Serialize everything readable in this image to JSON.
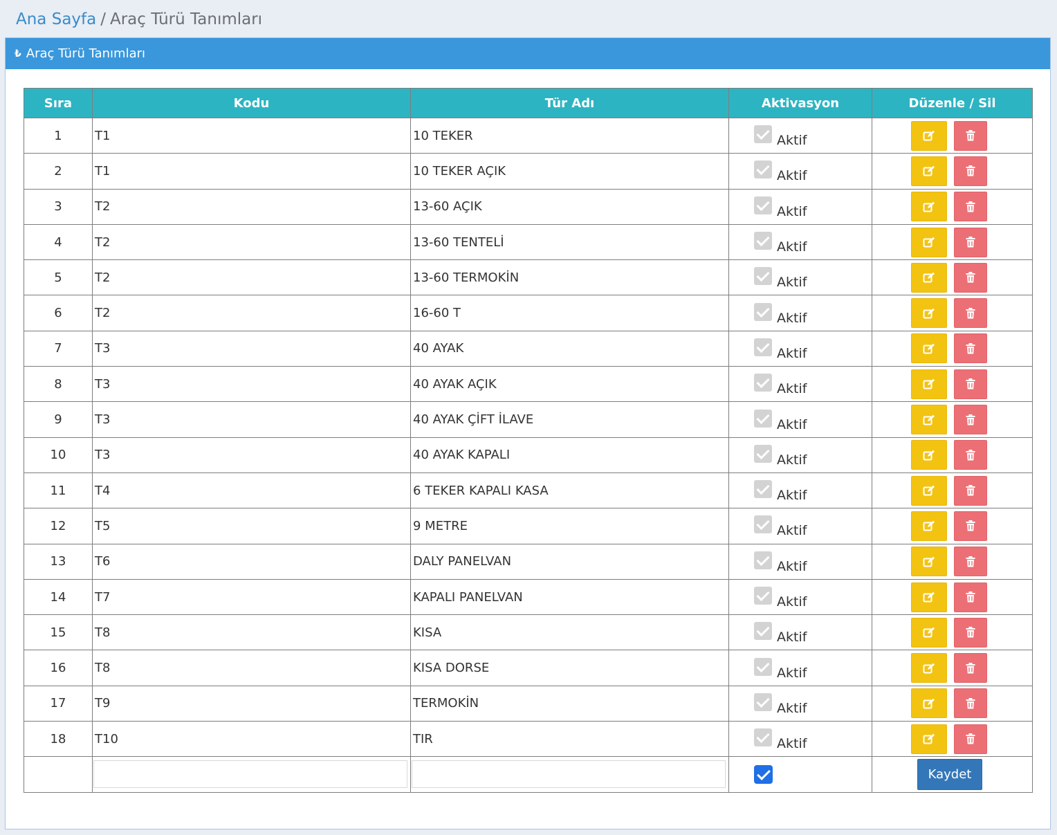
{
  "breadcrumb": {
    "home": "Ana Sayfa",
    "separator": "/",
    "current": "Araç Türü Tanımları"
  },
  "panel": {
    "title": "Araç Türü Tanımları",
    "title_icon": "lira-icon"
  },
  "table": {
    "headers": {
      "sira": "Sıra",
      "kodu": "Kodu",
      "tur": "Tür Adı",
      "aktivasyon": "Aktivasyon",
      "ops": "Düzenle / Sil"
    },
    "status_label": "Aktif",
    "rows": [
      {
        "sira": "1",
        "kodu": "T1",
        "tur": "10 TEKER"
      },
      {
        "sira": "2",
        "kodu": "T1",
        "tur": "10 TEKER AÇIK"
      },
      {
        "sira": "3",
        "kodu": "T2",
        "tur": "13-60 AÇIK"
      },
      {
        "sira": "4",
        "kodu": "T2",
        "tur": "13-60 TENTELİ"
      },
      {
        "sira": "5",
        "kodu": "T2",
        "tur": "13-60 TERMOKİN"
      },
      {
        "sira": "6",
        "kodu": "T2",
        "tur": "16-60 T"
      },
      {
        "sira": "7",
        "kodu": "T3",
        "tur": "40 AYAK"
      },
      {
        "sira": "8",
        "kodu": "T3",
        "tur": "40 AYAK AÇIK"
      },
      {
        "sira": "9",
        "kodu": "T3",
        "tur": "40 AYAK ÇİFT İLAVE"
      },
      {
        "sira": "10",
        "kodu": "T3",
        "tur": "40 AYAK KAPALI"
      },
      {
        "sira": "11",
        "kodu": "T4",
        "tur": "6 TEKER KAPALI KASA"
      },
      {
        "sira": "12",
        "kodu": "T5",
        "tur": "9 METRE"
      },
      {
        "sira": "13",
        "kodu": "T6",
        "tur": "DALY PANELVAN"
      },
      {
        "sira": "14",
        "kodu": "T7",
        "tur": "KAPALI PANELVAN"
      },
      {
        "sira": "15",
        "kodu": "T8",
        "tur": "KISA"
      },
      {
        "sira": "16",
        "kodu": "T8",
        "tur": "KISA DORSE"
      },
      {
        "sira": "17",
        "kodu": "T9",
        "tur": "TERMOKİN"
      },
      {
        "sira": "18",
        "kodu": "T10",
        "tur": "TIR"
      }
    ]
  },
  "new_row": {
    "kodu_value": "",
    "tur_value": "",
    "active_checked": true,
    "save_label": "Kaydet"
  },
  "colors": {
    "header": "#2db4c2",
    "panel_heading": "#3a97dc",
    "edit": "#f3c312",
    "delete": "#ec6f76",
    "save": "#3477b9"
  }
}
